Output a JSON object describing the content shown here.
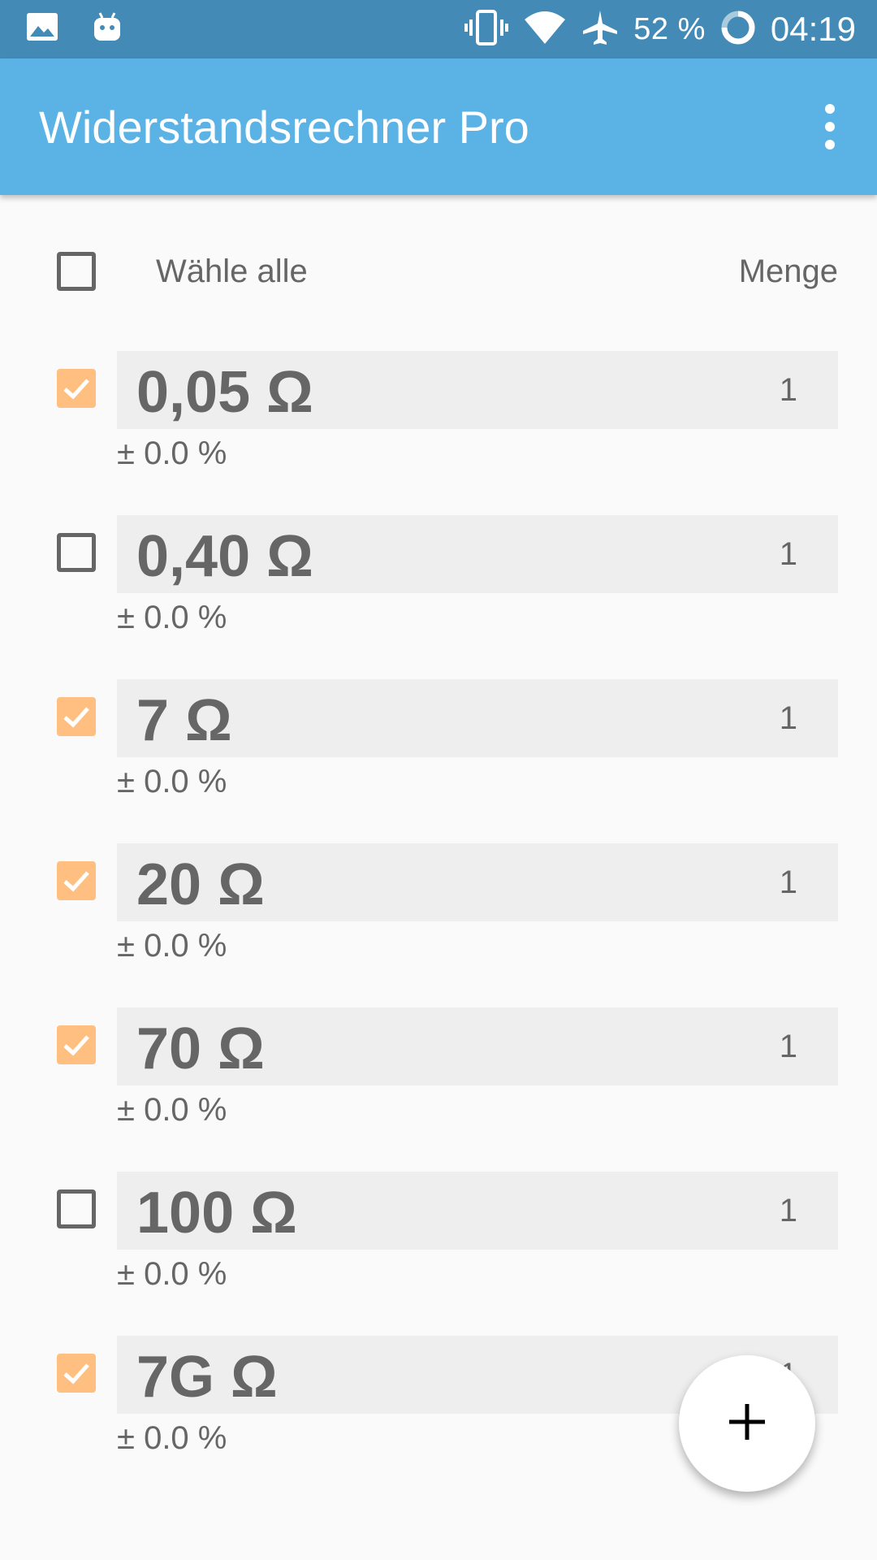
{
  "status_bar": {
    "battery": "52 %",
    "time": "04:19",
    "icons": [
      "image-icon",
      "android-icon",
      "vibrate-icon",
      "wifi-icon",
      "airplane-icon",
      "battery-icon"
    ]
  },
  "app_bar": {
    "title": "Widerstandsrechner Pro",
    "menu_icon": "more-vert-icon"
  },
  "list_header": {
    "select_all_label": "Wähle alle",
    "quantity_label": "Menge",
    "select_all_checked": false
  },
  "resistors": [
    {
      "value": "0,05 Ω",
      "quantity": "1",
      "tolerance": "± 0.0 %",
      "checked": true
    },
    {
      "value": "0,40 Ω",
      "quantity": "1",
      "tolerance": "± 0.0 %",
      "checked": false
    },
    {
      "value": "7 Ω",
      "quantity": "1",
      "tolerance": "± 0.0 %",
      "checked": true
    },
    {
      "value": "20 Ω",
      "quantity": "1",
      "tolerance": "± 0.0 %",
      "checked": true
    },
    {
      "value": "70 Ω",
      "quantity": "1",
      "tolerance": "± 0.0 %",
      "checked": true
    },
    {
      "value": "100 Ω",
      "quantity": "1",
      "tolerance": "± 0.0 %",
      "checked": false
    },
    {
      "value": "7G Ω",
      "quantity": "1",
      "tolerance": "± 0.0 %",
      "checked": true
    }
  ],
  "fab": {
    "icon": "add-icon"
  },
  "colors": {
    "status_bar": "#438ab7",
    "app_bar": "#5ab2e5",
    "checkbox_checked": "#ffbf80",
    "text": "#666666",
    "row_background": "#eeeeee"
  }
}
